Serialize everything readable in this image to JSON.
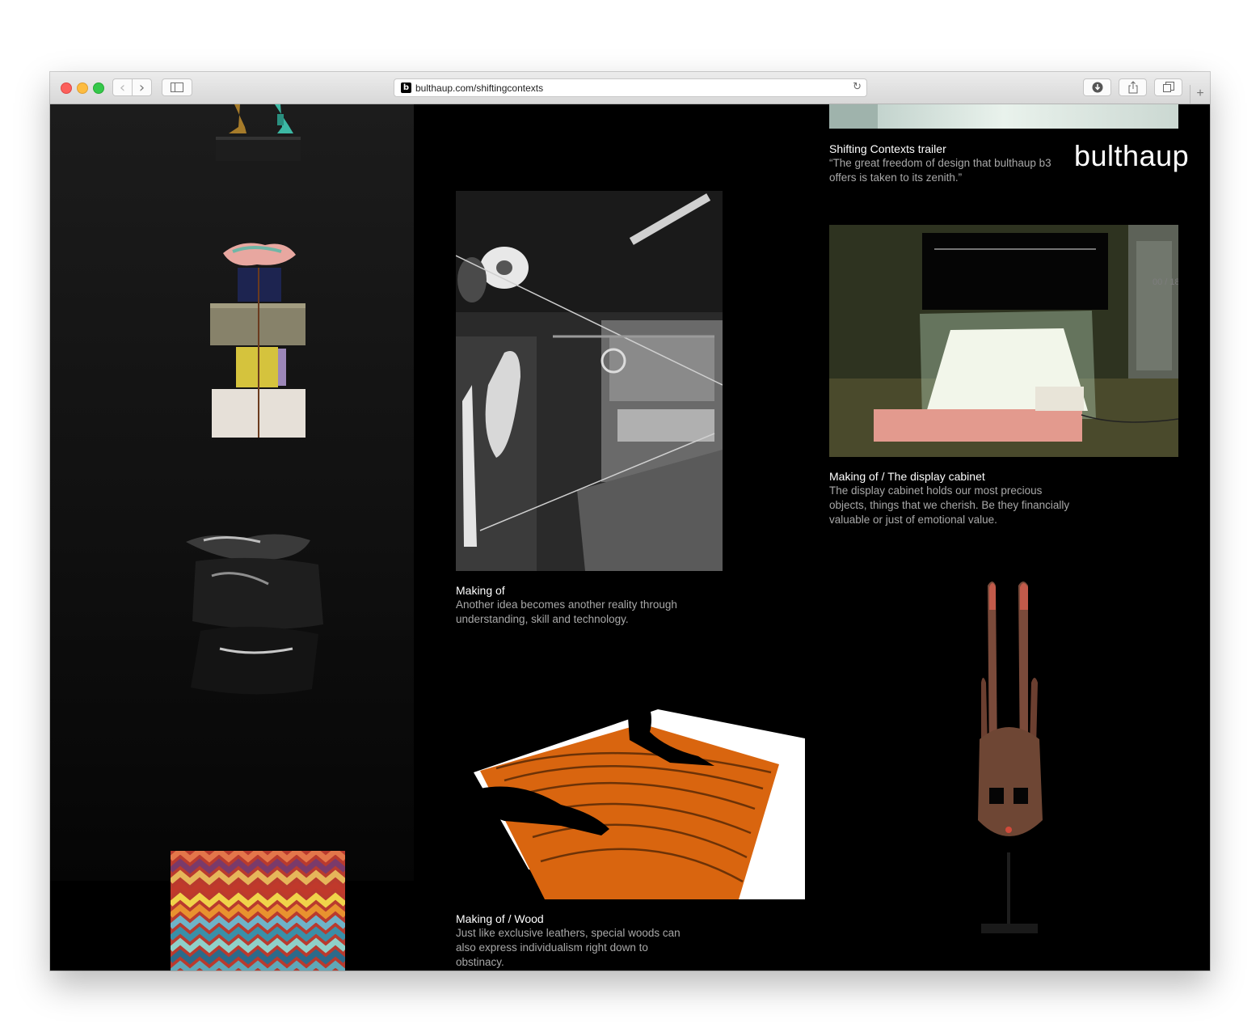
{
  "browser": {
    "url": "bulthaup.com/shiftingcontexts",
    "favicon_letter": "b",
    "back_icon": "‹",
    "forward_icon": "›",
    "reload_icon": "↻",
    "new_tab_icon": "+"
  },
  "brand": {
    "logo": "bulthaup"
  },
  "items": [
    {
      "title": "Shifting Contexts trailer",
      "body": "“The great freedom of design that bulthaup b3 offers is taken to its zenith.”"
    },
    {
      "title": "Making of",
      "body": "Another idea becomes another reality through understanding, skill and technology."
    },
    {
      "title": "Making of / The display cabinet",
      "body": "The display cabinet holds our most precious objects, things that we cherish. Be they financially valuable or just of emotional value."
    },
    {
      "title": "Making of / Wood",
      "body": "Just like exclusive leathers, special woods can also express individualism right down to obstinacy."
    }
  ],
  "overlay_hint": "00 / 18",
  "colors": {
    "page_background": "#000000",
    "caption_title": "#ffffff",
    "caption_body": "#a8a8a8",
    "wood_orange": "#d9650f",
    "light_table": "#ffffff"
  }
}
